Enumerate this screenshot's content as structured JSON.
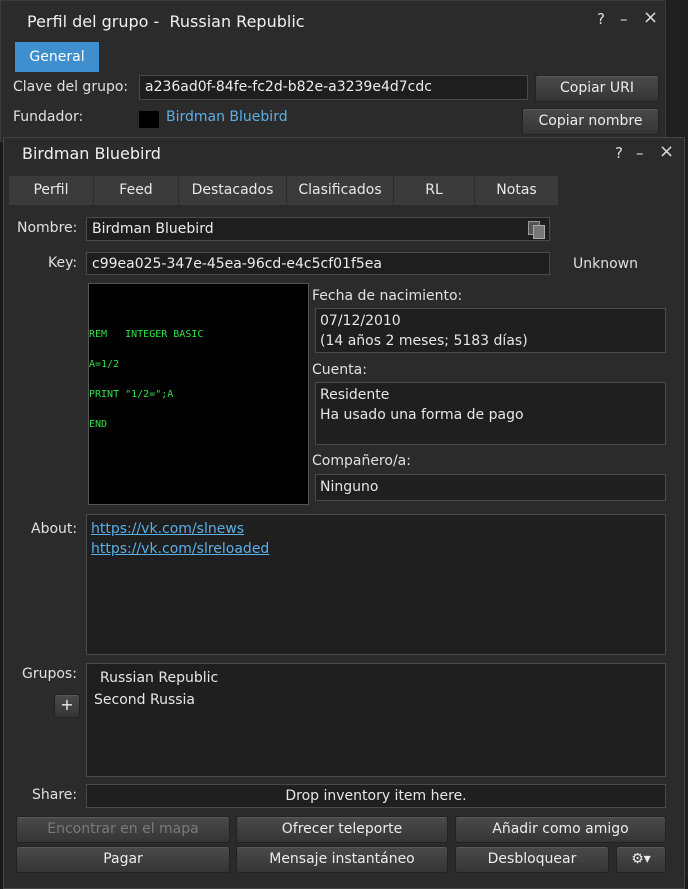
{
  "group_window": {
    "title": "Perfil del grupo -  Russian Republic",
    "help_icon": "?",
    "minimize_icon": "–",
    "close_icon": "×",
    "tab_general": "General",
    "group_key_label": "Clave del grupo:",
    "group_key_value": "a236ad0f-84fe-fc2d-b82e-a3239e4d7cdc",
    "copy_uri_button": "Copiar URI",
    "founder_label": "Fundador:",
    "founder_name": "Birdman Bluebird",
    "copy_name_button": "Copiar nombre"
  },
  "profile_window": {
    "title": "Birdman Bluebird",
    "help_icon": "?",
    "minimize_icon": "–",
    "close_icon": "×",
    "tabs": [
      "Perfil",
      "Feed",
      "Destacados",
      "Clasificados",
      "RL",
      "Notas"
    ],
    "name_label": "Nombre:",
    "name_value": "Birdman Bluebird",
    "key_label": "Key:",
    "key_value": "c99ea025-347e-45ea-96cd-e4c5cf01f5ea",
    "online_status": "Unknown",
    "profile_image_lines": [
      "REM   INTEGER BASIC",
      "A=1/2",
      "PRINT \"1/2=\";A",
      "END"
    ],
    "birth_label": "Fecha de nacimiento:",
    "birth_date": "07/12/2010",
    "birth_age": "(14 años 2 meses; 5183 días)",
    "account_label": "Cuenta:",
    "account_type": "Residente",
    "account_payment": "Ha usado una forma de pago",
    "partner_label": "Compañero/a:",
    "partner_value": "Ninguno",
    "about_label": "About:",
    "about_links": [
      {
        "prefix": "https://vk.com/",
        "suffix": "slnews"
      },
      {
        "prefix": "https://vk.com/",
        "suffix": "slreloaded"
      }
    ],
    "groups_label": "Grupos:",
    "groups": [
      "Russian Republic",
      "Second Russia"
    ],
    "add_group_button": "+",
    "share_label": "Share:",
    "share_drop_text": "Drop inventory item here.",
    "buttons": {
      "find_on_map": "Encontrar en el mapa",
      "offer_teleport": "Ofrecer teleporte",
      "add_friend": "Añadir como amigo",
      "pay": "Pagar",
      "instant_message": "Mensaje instantáneo",
      "unblock": "Desbloquear",
      "gear": "⚙▾"
    }
  },
  "colors": {
    "accent": "#3f8fcf",
    "link": "#5ab0e6",
    "terminal_green": "#2fe04a",
    "window_bg": "#2b2b2b"
  }
}
